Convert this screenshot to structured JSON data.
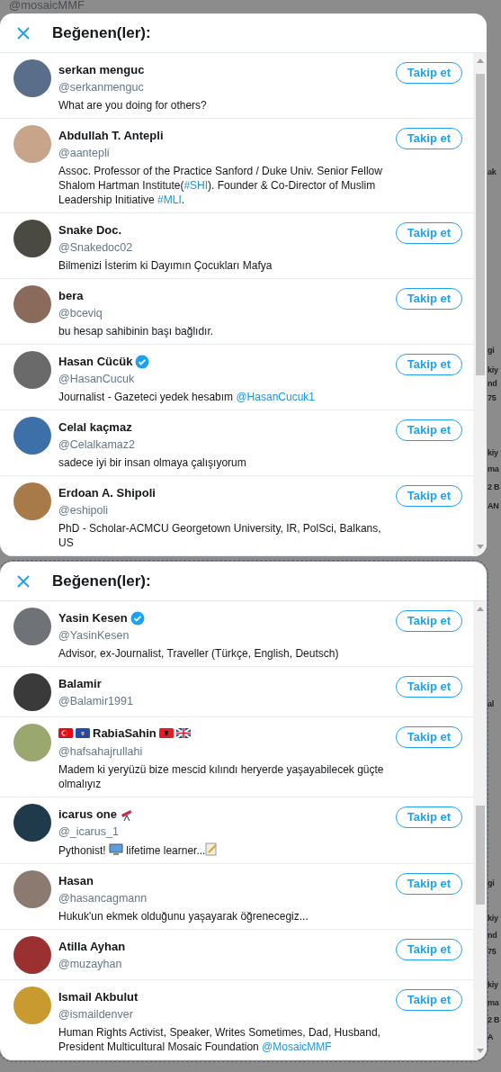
{
  "background": {
    "top_text": "@mosaicMMF",
    "side_texts": [
      "ak",
      "gi",
      "kiy",
      "nd",
      "75",
      "kiy",
      "ma",
      "2 B",
      "AN",
      "al",
      "gi",
      "kiy",
      "nd",
      "75",
      "kiy",
      "ma",
      "2 B",
      "A"
    ]
  },
  "modals": [
    {
      "title": "Beğenen(ler):",
      "users": [
        {
          "name": "serkan menguc",
          "verified": false,
          "handle": "@serkanmenguc",
          "bio": [
            {
              "kind": "text",
              "text": "What are you doing for others?"
            }
          ],
          "button": "Takip et",
          "color": "#5a6e8c"
        },
        {
          "name": "Abdullah T. Antepli",
          "verified": false,
          "handle": "@aantepli",
          "bio": [
            {
              "kind": "text",
              "text": "Assoc. Professor of the Practice Sanford / Duke Univ. Senior Fellow Shalom Hartman Institute("
            },
            {
              "kind": "link",
              "text": "#SHI"
            },
            {
              "kind": "text",
              "text": "). Founder & Co-Director of Muslim Leadership Initiative "
            },
            {
              "kind": "link",
              "text": "#MLI"
            },
            {
              "kind": "text",
              "text": "."
            }
          ],
          "button": "Takip et",
          "color": "#c8a58a"
        },
        {
          "name": "Snake Doc.",
          "verified": false,
          "handle": "@Snakedoc02",
          "bio": [
            {
              "kind": "text",
              "text": "Bilmenizi İsterim ki Dayımın Çocukları Mafya"
            }
          ],
          "button": "Takip et",
          "color": "#4a4a42"
        },
        {
          "name": "bera",
          "verified": false,
          "handle": "@bceviq",
          "bio": [
            {
              "kind": "text",
              "text": "bu hesap sahibinin başı bağlıdır."
            }
          ],
          "button": "Takip et",
          "color": "#8a6a5a"
        },
        {
          "name": "Hasan Cücük",
          "verified": true,
          "handle": "@HasanCucuk",
          "bio": [
            {
              "kind": "text",
              "text": "Journalist - Gazeteci yedek hesabım "
            },
            {
              "kind": "link",
              "text": "@HasanCucuk1"
            }
          ],
          "button": "Takip et",
          "color": "#6a6a6a"
        },
        {
          "name": "Celal kaçmaz",
          "verified": false,
          "handle": "@Celalkamaz2",
          "bio": [
            {
              "kind": "text",
              "text": "sadece iyi bir insan olmaya çalışıyorum"
            }
          ],
          "button": "Takip et",
          "color": "#3d6fa8"
        },
        {
          "name": "Erdoan A. Shipoli",
          "verified": false,
          "handle": "@eshipoli",
          "bio": [
            {
              "kind": "text",
              "text": "PhD - Scholar-ACMCU Georgetown University, IR, PolSci, Balkans, US"
            }
          ],
          "button": "Takip et",
          "color": "#a87a4a"
        }
      ]
    },
    {
      "title": "Beğenen(ler):",
      "users": [
        {
          "name": "Yasin Kesen",
          "verified": true,
          "handle": "@YasinKesen",
          "bio": [
            {
              "kind": "text",
              "text": "Advisor, ex-Journalist, Traveller (Türkçe, English, Deutsch)"
            }
          ],
          "button": "Takip et",
          "color": "#6f7378"
        },
        {
          "name": "Balamir",
          "verified": false,
          "handle": "@Balamir1991",
          "button": "Takip et",
          "color": "#3a3a3a"
        },
        {
          "name": "RabiaSahin",
          "icons_before": [
            {
              "kind": "flag_tr"
            },
            {
              "kind": "flag_xk"
            }
          ],
          "icons_after": [
            {
              "kind": "flag_al"
            },
            {
              "kind": "flag_gb"
            }
          ],
          "verified": false,
          "handle": "@hafsahajrullahi",
          "bio": [
            {
              "kind": "text",
              "text": "Madem ki yeryüzü bize mescid kılındı heryerde yaşayabilecek güçte olmalıyız"
            }
          ],
          "button": "Takip et",
          "color": "#9aa870"
        },
        {
          "name": "icarus one",
          "icons_after": [
            {
              "kind": "telescope"
            }
          ],
          "verified": false,
          "handle": "@_icarus_1",
          "bio": [
            {
              "kind": "text",
              "text": "Pythonist! "
            },
            {
              "kind": "computer"
            },
            {
              "kind": "text",
              "text": " lifetime learner..."
            },
            {
              "kind": "memo"
            }
          ],
          "button": "Takip et",
          "color": "#1f3a4a"
        },
        {
          "name": "Hasan",
          "verified": false,
          "handle": "@hasancagmann",
          "bio": [
            {
              "kind": "text",
              "text": "Hukuk'un ekmek olduğunu yaşayarak öğrenecegiz..."
            }
          ],
          "button": "Takip et",
          "color": "#8a7a70"
        },
        {
          "name": "Atilla Ayhan",
          "verified": false,
          "handle": "@muzayhan",
          "button": "Takip et",
          "color": "#9a3030"
        },
        {
          "name": "Ismail Akbulut",
          "verified": false,
          "handle": "@ismaildenver",
          "bio": [
            {
              "kind": "text",
              "text": "Human Rights Activist, Speaker, Writes Sometimes, Dad, Husband, President Multicultural Mosaic Foundation "
            },
            {
              "kind": "link",
              "text": "@MosaicMMF"
            }
          ],
          "button": "Takip et",
          "color": "#c89a30"
        }
      ]
    }
  ]
}
